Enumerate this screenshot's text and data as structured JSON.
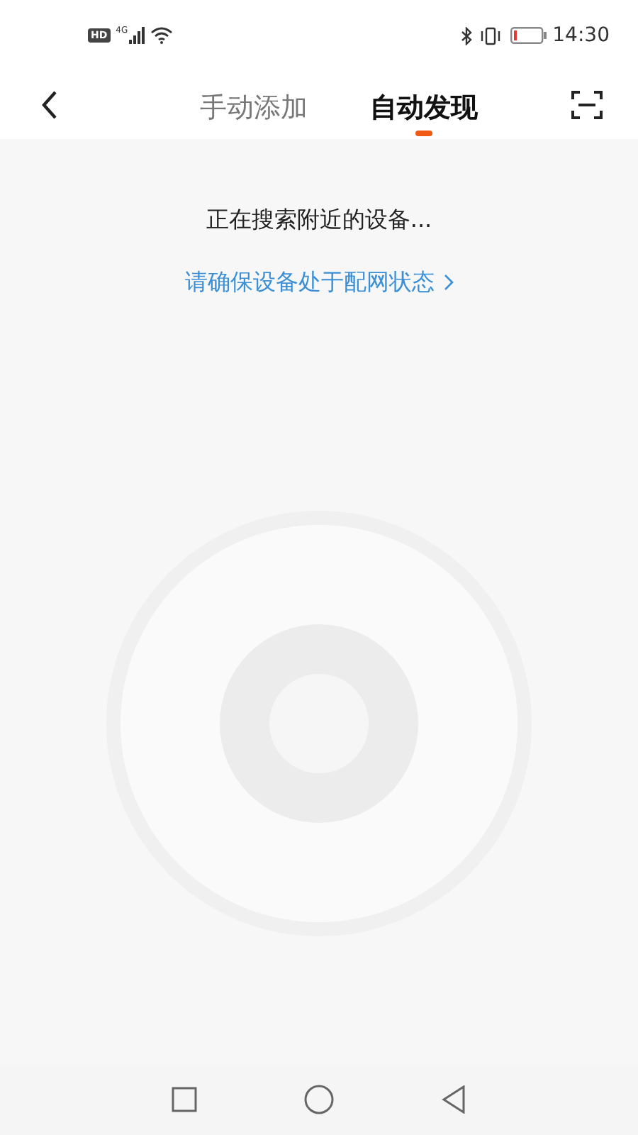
{
  "status_bar": {
    "hd": "HD",
    "network": "4G",
    "time": "14:30"
  },
  "tabs": [
    {
      "label": "手动添加",
      "selected": false
    },
    {
      "label": "自动发现",
      "selected": true
    }
  ],
  "status_text": "正在搜索附近的设备...",
  "hint_link": "请确保设备处于配网状态"
}
